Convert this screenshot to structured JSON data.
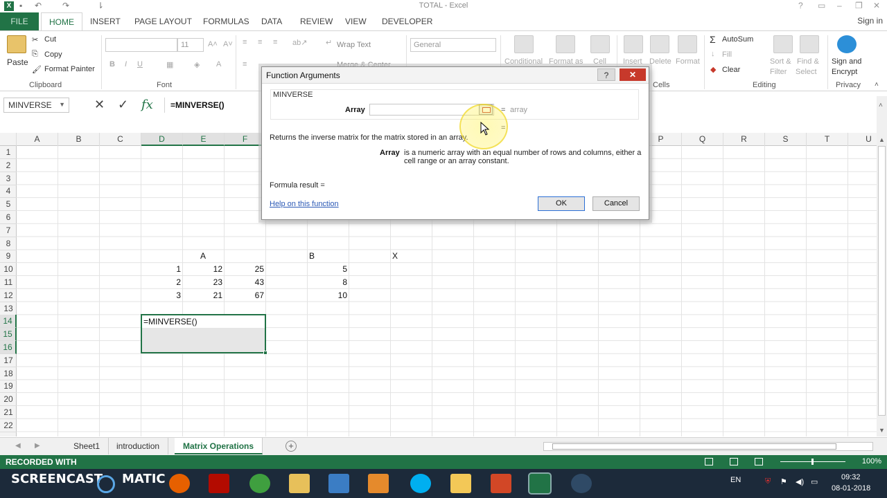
{
  "window": {
    "title": "TOTAL - Excel",
    "signin": "Sign in"
  },
  "tabs": {
    "file": "FILE",
    "home": "HOME",
    "insert": "INSERT",
    "page_layout": "PAGE LAYOUT",
    "formulas": "FORMULAS",
    "data": "DATA",
    "review": "REVIEW",
    "view": "VIEW",
    "developer": "DEVELOPER"
  },
  "ribbon": {
    "paste": "Paste",
    "cut": "Cut",
    "copy": "Copy",
    "format_painter": "Format Painter",
    "clipboard": "Clipboard",
    "font_size": "11",
    "font": "Font",
    "wrap_text": "Wrap Text",
    "merge_center": "Merge & Center",
    "number_format": "General",
    "conditional": "Conditional",
    "format_as": "Format as",
    "cell": "Cell",
    "insert": "Insert",
    "delete": "Delete",
    "format": "Format",
    "cells": "Cells",
    "autosum": "AutoSum",
    "fill": "Fill",
    "clear": "Clear",
    "sort_filter_1": "Sort &",
    "sort_filter_2": "Filter",
    "find_select_1": "Find &",
    "find_select_2": "Select",
    "editing": "Editing",
    "sign_encrypt_1": "Sign and",
    "sign_encrypt_2": "Encrypt",
    "privacy": "Privacy"
  },
  "formula_bar": {
    "name_box": "MINVERSE",
    "fx": "fx",
    "formula": "=MINVERSE()"
  },
  "columns": [
    "A",
    "B",
    "C",
    "D",
    "E",
    "F",
    "G",
    "H",
    "I",
    "J",
    "K",
    "L",
    "M",
    "N",
    "O",
    "P",
    "Q",
    "R",
    "S",
    "T",
    "U"
  ],
  "rows": [
    "1",
    "2",
    "3",
    "4",
    "5",
    "6",
    "7",
    "8",
    "9",
    "10",
    "11",
    "12",
    "13",
    "14",
    "15",
    "16",
    "17",
    "18",
    "19",
    "20",
    "21",
    "22"
  ],
  "cells": {
    "label_a": "A",
    "label_b": "B",
    "label_x": "X",
    "matrix_a": [
      [
        "1",
        "12",
        "25"
      ],
      [
        "2",
        "23",
        "43"
      ],
      [
        "3",
        "21",
        "67"
      ]
    ],
    "matrix_b": [
      "5",
      "8",
      "10"
    ],
    "d14": "=MINVERSE()"
  },
  "dialog": {
    "title": "Function Arguments",
    "help_btn": "?",
    "close_btn": "✕",
    "function_name": "MINVERSE",
    "arg_label": "Array",
    "arg_hint": "array",
    "eq": "=",
    "description": "Returns the inverse matrix for the matrix stored in an array.",
    "arg_name": "Array",
    "arg_desc": "is a numeric array with an equal number of rows and columns, either a cell range or an array constant.",
    "formula_result": "Formula result =",
    "help_link": "Help on this function",
    "ok": "OK",
    "cancel": "Cancel"
  },
  "sheets": {
    "tabs": [
      "Sheet1",
      "introduction",
      "Matrix Operations"
    ],
    "active": "Matrix Operations"
  },
  "status": {
    "recorded": "RECORDED WITH",
    "zoom": "100%"
  },
  "taskbar": {
    "brand_1": "SCREENCAST",
    "brand_2": "MATIC",
    "lang": "EN",
    "time": "09:32",
    "date": "08-01-2018"
  },
  "colors": {
    "excel_green": "#217346",
    "close_red": "#c7392b",
    "link_blue": "#2a58b5"
  }
}
